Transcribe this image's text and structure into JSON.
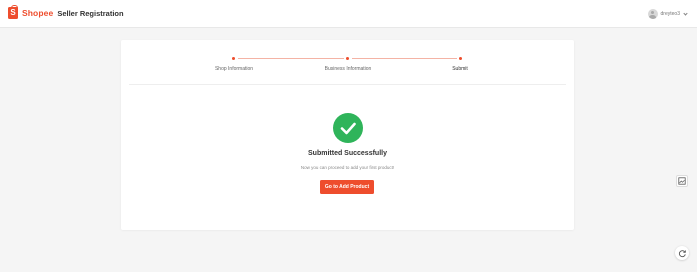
{
  "header": {
    "brand_glyph": "S",
    "brand_name": "Shopee",
    "title": "Seller Registration",
    "username": "dreyteo3"
  },
  "steps": [
    {
      "label": "Shop Information",
      "status": "completed"
    },
    {
      "label": "Business Information",
      "status": "completed"
    },
    {
      "label": "Submit",
      "status": "current"
    }
  ],
  "result": {
    "title": "Submitted Successfully",
    "description": "Now you can proceed to add your first product!",
    "button_label": "Go to Add Product"
  },
  "colors": {
    "brand": "#ee4d2d",
    "success": "#2fb45a",
    "step_line": "#f4b3a5"
  },
  "icons": {
    "side_panel": "image-frame-icon",
    "floating": "refresh-icon"
  }
}
